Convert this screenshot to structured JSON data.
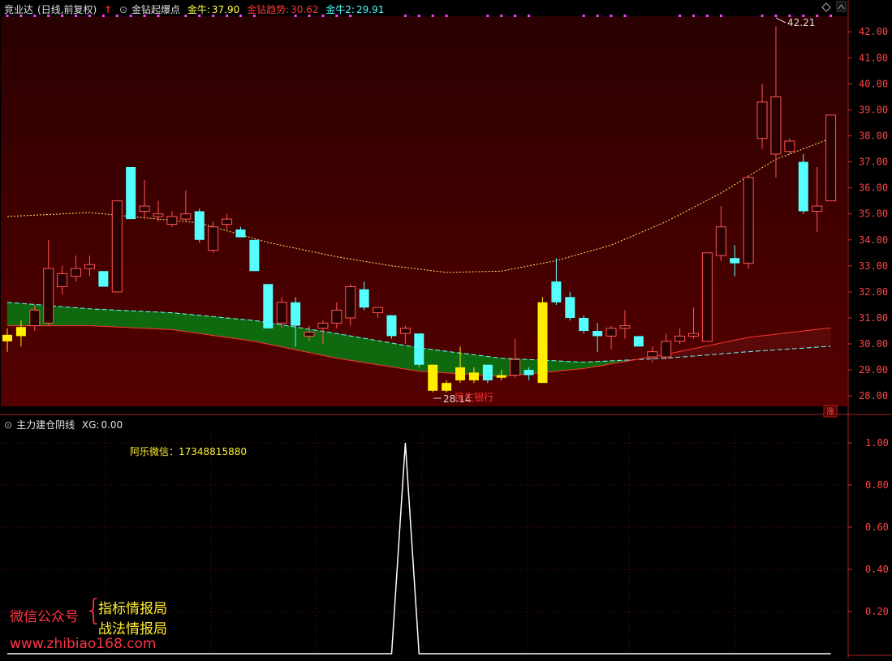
{
  "header": {
    "stock_name": "竞业达",
    "period": "(日线,前复权)",
    "indicator_name": "金钻起爆点",
    "values": [
      {
        "label": "金牛:",
        "value": "37.90",
        "color": "#ffff55"
      },
      {
        "label": "金钻趋势:",
        "value": "30.62",
        "color": "#ff3333"
      },
      {
        "label": "金牛2:",
        "value": "29.91",
        "color": "#55ffff"
      }
    ]
  },
  "sub_header": {
    "indicator_name": "主力建仓阴线",
    "value_label": "XG:",
    "value": "0.00"
  },
  "contact_text": "阿乐微信：17348815880",
  "price_annotations": {
    "high": "42.21",
    "low": "28.14",
    "label": "民生银行"
  },
  "corner_badge": "涨",
  "promo": {
    "wechat_label": "微信公众号",
    "brace": "{",
    "line1": "指标情报局",
    "line2": "战法情报局",
    "url": "www.zhibiao168.com"
  },
  "colors": {
    "up": "#ff5555",
    "down": "#55ffff",
    "signal": "#ffee00",
    "bg_red": "#250000",
    "ribbon_up": "#0f6a0f",
    "ribbon_down": "#5a0808"
  },
  "chart_data": [
    {
      "type": "candlestick",
      "ylim": [
        27.6,
        42.6
      ],
      "yticks": [
        "42.00",
        "41.00",
        "40.00",
        "39.00",
        "38.00",
        "37.00",
        "36.00",
        "35.00",
        "34.00",
        "33.00",
        "32.00",
        "31.00",
        "30.00",
        "29.00",
        "28.00"
      ],
      "candles": [
        {
          "o": 30.1,
          "h": 30.6,
          "l": 29.7,
          "c": 30.35,
          "dir": "signal"
        },
        {
          "o": 30.3,
          "h": 30.9,
          "l": 29.9,
          "c": 30.65,
          "dir": "signal"
        },
        {
          "o": 30.7,
          "h": 31.5,
          "l": 30.5,
          "c": 31.3,
          "dir": "up"
        },
        {
          "o": 30.8,
          "h": 34.0,
          "l": 30.7,
          "c": 32.9,
          "dir": "up"
        },
        {
          "o": 32.2,
          "h": 33.0,
          "l": 31.9,
          "c": 32.7,
          "dir": "up"
        },
        {
          "o": 32.6,
          "h": 33.4,
          "l": 32.4,
          "c": 32.9,
          "dir": "up"
        },
        {
          "o": 32.9,
          "h": 33.4,
          "l": 32.6,
          "c": 33.05,
          "dir": "up"
        },
        {
          "o": 32.8,
          "h": 32.8,
          "l": 32.2,
          "c": 32.2,
          "dir": "down"
        },
        {
          "o": 32.0,
          "h": 35.5,
          "l": 32.0,
          "c": 35.5,
          "dir": "up"
        },
        {
          "o": 36.8,
          "h": 36.8,
          "l": 34.8,
          "c": 34.8,
          "dir": "down"
        },
        {
          "o": 35.1,
          "h": 36.3,
          "l": 34.8,
          "c": 35.3,
          "dir": "up"
        },
        {
          "o": 34.9,
          "h": 35.5,
          "l": 34.7,
          "c": 35.0,
          "dir": "up"
        },
        {
          "o": 34.6,
          "h": 35.1,
          "l": 34.5,
          "c": 34.9,
          "dir": "up"
        },
        {
          "o": 34.8,
          "h": 35.9,
          "l": 34.7,
          "c": 35.0,
          "dir": "up"
        },
        {
          "o": 35.1,
          "h": 35.2,
          "l": 33.9,
          "c": 34.0,
          "dir": "down"
        },
        {
          "o": 33.6,
          "h": 34.7,
          "l": 33.5,
          "c": 34.5,
          "dir": "up"
        },
        {
          "o": 34.6,
          "h": 35.0,
          "l": 34.4,
          "c": 34.8,
          "dir": "up"
        },
        {
          "o": 34.4,
          "h": 34.5,
          "l": 34.1,
          "c": 34.1,
          "dir": "down"
        },
        {
          "o": 34.0,
          "h": 34.0,
          "l": 32.8,
          "c": 32.8,
          "dir": "down"
        },
        {
          "o": 32.3,
          "h": 32.3,
          "l": 30.6,
          "c": 30.6,
          "dir": "down"
        },
        {
          "o": 30.8,
          "h": 31.8,
          "l": 30.6,
          "c": 31.6,
          "dir": "up"
        },
        {
          "o": 31.6,
          "h": 31.8,
          "l": 29.9,
          "c": 30.7,
          "dir": "down"
        },
        {
          "o": 30.3,
          "h": 30.7,
          "l": 30.1,
          "c": 30.45,
          "dir": "up"
        },
        {
          "o": 30.6,
          "h": 30.9,
          "l": 30.0,
          "c": 30.8,
          "dir": "up"
        },
        {
          "o": 30.8,
          "h": 31.6,
          "l": 30.6,
          "c": 31.3,
          "dir": "up"
        },
        {
          "o": 31.0,
          "h": 32.3,
          "l": 30.7,
          "c": 32.2,
          "dir": "up"
        },
        {
          "o": 32.1,
          "h": 32.4,
          "l": 31.3,
          "c": 31.4,
          "dir": "down"
        },
        {
          "o": 31.2,
          "h": 31.4,
          "l": 31.0,
          "c": 31.4,
          "dir": "up"
        },
        {
          "o": 31.1,
          "h": 31.1,
          "l": 30.2,
          "c": 30.3,
          "dir": "down"
        },
        {
          "o": 30.4,
          "h": 30.7,
          "l": 30.0,
          "c": 30.6,
          "dir": "up"
        },
        {
          "o": 30.4,
          "h": 30.4,
          "l": 29.1,
          "c": 29.2,
          "dir": "down"
        },
        {
          "o": 29.2,
          "h": 29.2,
          "l": 28.14,
          "c": 28.2,
          "dir": "signal"
        },
        {
          "o": 28.2,
          "h": 28.6,
          "l": 28.14,
          "c": 28.5,
          "dir": "signal"
        },
        {
          "o": 28.6,
          "h": 29.9,
          "l": 28.5,
          "c": 29.1,
          "dir": "signal"
        },
        {
          "o": 28.9,
          "h": 29.1,
          "l": 28.5,
          "c": 28.6,
          "dir": "signal"
        },
        {
          "o": 29.2,
          "h": 29.2,
          "l": 28.5,
          "c": 28.6,
          "dir": "down"
        },
        {
          "o": 28.7,
          "h": 29.0,
          "l": 28.6,
          "c": 28.8,
          "dir": "signal"
        },
        {
          "o": 28.8,
          "h": 30.2,
          "l": 28.7,
          "c": 29.4,
          "dir": "up"
        },
        {
          "o": 29.0,
          "h": 29.1,
          "l": 28.6,
          "c": 28.8,
          "dir": "down"
        },
        {
          "o": 28.5,
          "h": 31.8,
          "l": 28.5,
          "c": 31.6,
          "dir": "signal"
        },
        {
          "o": 32.4,
          "h": 33.3,
          "l": 31.5,
          "c": 31.6,
          "dir": "down"
        },
        {
          "o": 31.8,
          "h": 32.0,
          "l": 30.9,
          "c": 31.0,
          "dir": "down"
        },
        {
          "o": 31.0,
          "h": 31.1,
          "l": 30.4,
          "c": 30.5,
          "dir": "down"
        },
        {
          "o": 30.5,
          "h": 30.8,
          "l": 29.7,
          "c": 30.3,
          "dir": "down"
        },
        {
          "o": 30.3,
          "h": 30.7,
          "l": 29.8,
          "c": 30.6,
          "dir": "up"
        },
        {
          "o": 30.6,
          "h": 31.3,
          "l": 30.2,
          "c": 30.7,
          "dir": "up"
        },
        {
          "o": 30.3,
          "h": 30.3,
          "l": 29.9,
          "c": 29.9,
          "dir": "down"
        },
        {
          "o": 29.5,
          "h": 29.9,
          "l": 29.3,
          "c": 29.7,
          "dir": "up"
        },
        {
          "o": 29.5,
          "h": 30.4,
          "l": 29.4,
          "c": 30.1,
          "dir": "up"
        },
        {
          "o": 30.1,
          "h": 30.6,
          "l": 30.0,
          "c": 30.3,
          "dir": "up"
        },
        {
          "o": 30.3,
          "h": 31.4,
          "l": 30.2,
          "c": 30.4,
          "dir": "up"
        },
        {
          "o": 30.1,
          "h": 33.5,
          "l": 30.1,
          "c": 33.5,
          "dir": "up"
        },
        {
          "o": 33.4,
          "h": 35.3,
          "l": 33.2,
          "c": 34.5,
          "dir": "up"
        },
        {
          "o": 33.3,
          "h": 33.8,
          "l": 32.6,
          "c": 33.1,
          "dir": "down"
        },
        {
          "o": 33.1,
          "h": 36.4,
          "l": 32.9,
          "c": 36.4,
          "dir": "up"
        },
        {
          "o": 37.9,
          "h": 40.0,
          "l": 37.5,
          "c": 39.3,
          "dir": "up"
        },
        {
          "o": 37.3,
          "h": 42.21,
          "l": 36.4,
          "c": 39.5,
          "dir": "up"
        },
        {
          "o": 37.4,
          "h": 37.9,
          "l": 37.3,
          "c": 37.8,
          "dir": "up"
        },
        {
          "o": 37.0,
          "h": 37.3,
          "l": 35.0,
          "c": 35.1,
          "dir": "down"
        },
        {
          "o": 35.1,
          "h": 36.8,
          "l": 34.3,
          "c": 35.3,
          "dir": "up"
        },
        {
          "o": 35.5,
          "h": 38.8,
          "l": 35.5,
          "c": 38.8,
          "dir": "up"
        }
      ],
      "ma_yellow": [
        [
          0,
          34.9
        ],
        [
          6,
          35.05
        ],
        [
          10,
          34.85
        ],
        [
          14,
          34.65
        ],
        [
          19,
          33.9
        ],
        [
          24,
          33.35
        ],
        [
          28,
          33.0
        ],
        [
          32,
          32.75
        ],
        [
          36,
          32.8
        ],
        [
          40,
          33.2
        ],
        [
          44,
          33.8
        ],
        [
          48,
          34.7
        ],
        [
          52,
          35.8
        ],
        [
          56,
          37.1
        ],
        [
          60,
          37.9
        ]
      ],
      "ribbon_upper": [
        [
          0,
          31.6
        ],
        [
          6,
          31.35
        ],
        [
          12,
          31.2
        ],
        [
          18,
          30.9
        ],
        [
          24,
          30.4
        ],
        [
          30,
          29.85
        ],
        [
          36,
          29.45
        ],
        [
          42,
          29.3
        ],
        [
          48,
          29.45
        ],
        [
          54,
          29.7
        ],
        [
          60,
          29.91
        ]
      ],
      "ribbon_lower": [
        [
          0,
          30.7
        ],
        [
          6,
          30.7
        ],
        [
          12,
          30.55
        ],
        [
          18,
          30.1
        ],
        [
          24,
          29.45
        ],
        [
          30,
          28.95
        ],
        [
          36,
          28.75
        ],
        [
          42,
          29.05
        ],
        [
          48,
          29.6
        ],
        [
          54,
          30.25
        ],
        [
          60,
          30.62
        ]
      ],
      "signal_dots_top": [
        [
          0,
          4
        ],
        [
          5,
          11
        ],
        [
          13,
          18
        ],
        [
          21,
          25
        ],
        [
          29,
          32
        ],
        [
          35,
          38
        ],
        [
          42,
          45
        ],
        [
          49,
          52
        ],
        [
          55,
          60
        ]
      ]
    },
    {
      "type": "line",
      "ylim": [
        0,
        1.1
      ],
      "yticks": [
        "1.00",
        "0.80",
        "0.60",
        "0.40",
        "0.20"
      ],
      "series": [
        {
          "values_x": [
            0,
            28,
            29,
            30,
            60
          ],
          "values_y": [
            0,
            0,
            1,
            0,
            0
          ]
        }
      ]
    }
  ]
}
